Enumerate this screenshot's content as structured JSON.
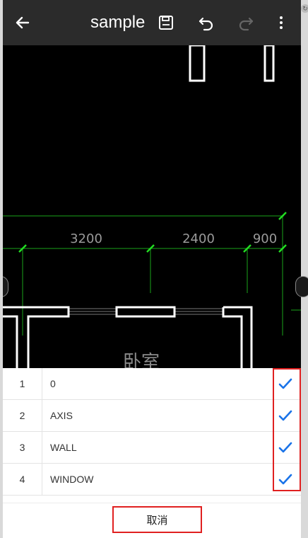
{
  "toolbar": {
    "title": "sample",
    "icons": [
      "back-arrow-icon",
      "save-icon",
      "undo-icon",
      "redo-icon",
      "more-vert-icon"
    ]
  },
  "drawing": {
    "dimensions": [
      "3200",
      "2400",
      "900"
    ],
    "room_label": "卧室",
    "colors": {
      "dimension_line": "#1aa31a",
      "tick": "#22dd22",
      "wall": "#ffffff",
      "text": "#9a9a9a"
    }
  },
  "layers": [
    {
      "index": "1",
      "name": "0",
      "checked": true
    },
    {
      "index": "2",
      "name": "AXIS",
      "checked": true
    },
    {
      "index": "3",
      "name": "WALL",
      "checked": true
    },
    {
      "index": "4",
      "name": "WINDOW",
      "checked": true
    }
  ],
  "cancel_label": "取消",
  "colors": {
    "check": "#1a73e8",
    "highlight": "#e02020"
  }
}
